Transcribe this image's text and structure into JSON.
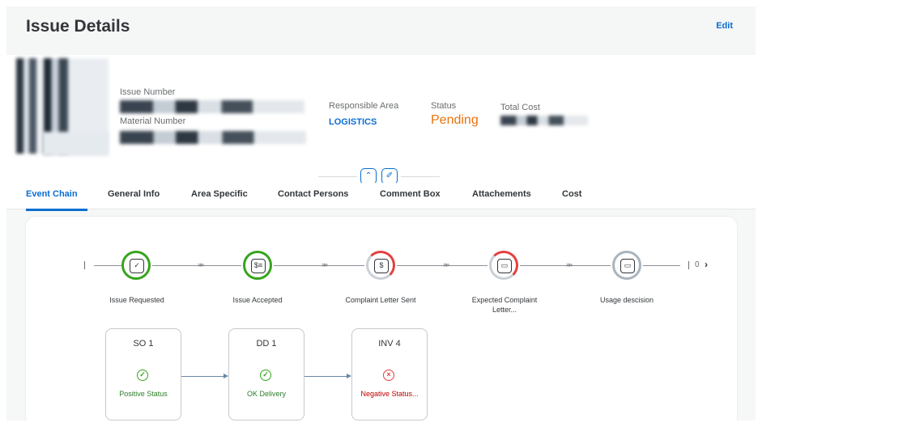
{
  "header": {
    "title": "Issue Details",
    "edit_label": "Edit"
  },
  "fields": {
    "issue_number_label": "Issue Number",
    "material_number_label": "Material Number",
    "responsible_area_label": "Responsible Area",
    "responsible_area_value": "LOGISTICS",
    "status_label": "Status",
    "status_value": "Pending",
    "total_cost_label": "Total Cost"
  },
  "tabs": [
    {
      "label": "Event Chain",
      "active": true
    },
    {
      "label": "General Info",
      "active": false
    },
    {
      "label": "Area Specific",
      "active": false
    },
    {
      "label": "Contact Persons",
      "active": false
    },
    {
      "label": "Comment Box",
      "active": false
    },
    {
      "label": "Attachements",
      "active": false
    },
    {
      "label": "Cost",
      "active": false
    }
  ],
  "event_chain": {
    "pager_text": "0",
    "steps": [
      {
        "label": "Issue Requested",
        "state": "complete",
        "icon": "document-check-icon",
        "glyph": "✓"
      },
      {
        "label": "Issue Accepted",
        "state": "complete",
        "icon": "invoice-icon",
        "glyph": "$≡"
      },
      {
        "label": "Complaint Letter Sent",
        "state": "partial",
        "icon": "dollar-document-icon",
        "glyph": "$"
      },
      {
        "label": "Expected Complaint Letter...",
        "state": "partial",
        "icon": "money-bills-icon",
        "glyph": "▭"
      },
      {
        "label": "Usage descision",
        "state": "open",
        "icon": "money-bills-icon",
        "glyph": "▭"
      }
    ],
    "documents": [
      {
        "title": "SO 1",
        "status": "Positive Status",
        "tone": "positive"
      },
      {
        "title": "DD 1",
        "status": "OK Delivery",
        "tone": "positive"
      },
      {
        "title": "INV 4",
        "status": "Negative Status...",
        "tone": "negative"
      }
    ]
  },
  "colors": {
    "accent": "#0a6ed1",
    "pending": "#e9730c",
    "positive": "#2b7d2b",
    "positive_ring": "#36a41d",
    "negative": "#bb0000",
    "negative_ring": "#e34040",
    "neutral_ring": "#a9b4be"
  }
}
